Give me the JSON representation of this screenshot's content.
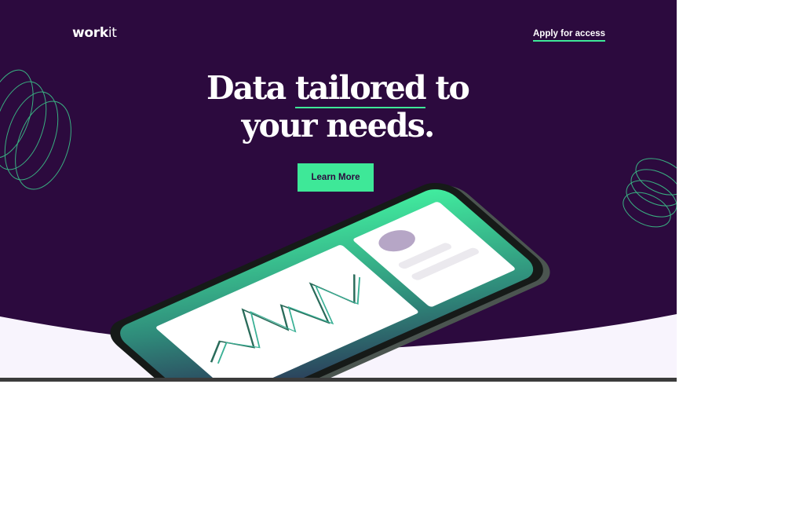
{
  "header": {
    "logo_bold": "work",
    "logo_light": "it",
    "nav_link": "Apply for access"
  },
  "hero": {
    "headline_part1": "Data ",
    "headline_highlight": "tailored",
    "headline_part2": " to your needs.",
    "cta_label": "Learn More"
  },
  "colors": {
    "background": "#2c0a3e",
    "accent": "#3ee898",
    "lower_section": "#f8f4fd"
  },
  "icons": {
    "left_decoration": "spiral-rings",
    "right_decoration": "spiral-rings",
    "device": "smartphone-mockup"
  }
}
